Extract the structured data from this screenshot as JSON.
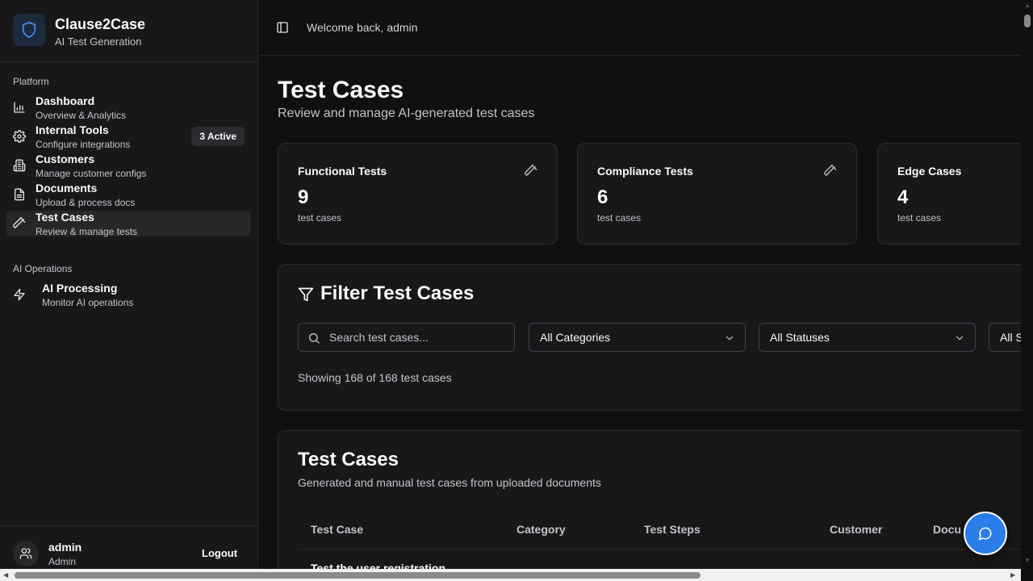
{
  "brand": {
    "name": "Clause2Case",
    "subtitle": "AI Test Generation"
  },
  "sidebar": {
    "groups": [
      {
        "label": "Platform"
      },
      {
        "label": "AI Operations"
      }
    ],
    "items": [
      {
        "title": "Dashboard",
        "subtitle": "Overview & Analytics",
        "icon": "bar-chart-icon"
      },
      {
        "title": "Internal Tools",
        "subtitle": "Configure integrations",
        "icon": "gear-icon",
        "badge": "3 Active"
      },
      {
        "title": "Customers",
        "subtitle": "Manage customer configs",
        "icon": "building-icon"
      },
      {
        "title": "Documents",
        "subtitle": "Upload & process docs",
        "icon": "document-icon"
      },
      {
        "title": "Test Cases",
        "subtitle": "Review & manage tests",
        "icon": "test-tube-icon",
        "active": true
      },
      {
        "title": "AI Processing",
        "subtitle": "Monitor AI operations",
        "icon": "lightning-icon"
      }
    ]
  },
  "user": {
    "name": "admin",
    "role": "Admin",
    "logout_label": "Logout"
  },
  "header": {
    "welcome_prefix": "Welcome back,",
    "welcome_user": "admin"
  },
  "page": {
    "title": "Test Cases",
    "subtitle": "Review and manage AI-generated test cases"
  },
  "stats": [
    {
      "title": "Functional Tests",
      "value": "9",
      "unit": "test cases"
    },
    {
      "title": "Compliance Tests",
      "value": "6",
      "unit": "test cases"
    },
    {
      "title": "Edge Cases",
      "value": "4",
      "unit": "test cases"
    }
  ],
  "filter": {
    "title": "Filter Test Cases",
    "search_placeholder": "Search test cases...",
    "category_value": "All Categories",
    "status_value": "All Statuses",
    "third_value": "All S",
    "showing": "Showing 168 of 168 test cases"
  },
  "table": {
    "title": "Test Cases",
    "subtitle": "Generated and manual test cases from uploaded documents",
    "columns": [
      "Test Case",
      "Category",
      "Test Steps",
      "Customer",
      "Docu"
    ],
    "first_row_text": "Test the user registration"
  },
  "colors": {
    "accent": "#2b7de9",
    "background": "#101011",
    "surface": "#18181b",
    "border": "#27272a"
  }
}
